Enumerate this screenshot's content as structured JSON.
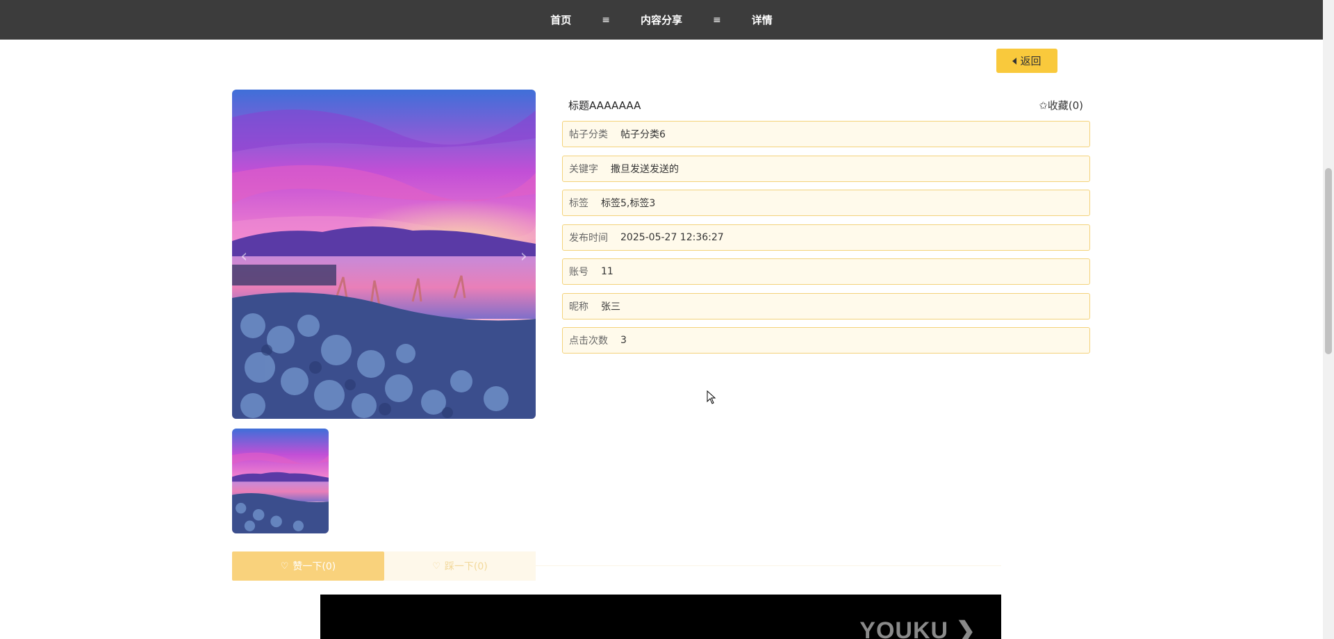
{
  "nav": {
    "crumbs": [
      "首页",
      "内容分享",
      "详情"
    ],
    "separator": "≡"
  },
  "back_button": {
    "label": "返回"
  },
  "post": {
    "title": "标题AAAAAAA",
    "favorite_label": "✩收藏(0)"
  },
  "fields": [
    {
      "key": "帖子分类",
      "value": "帖子分类6"
    },
    {
      "key": "关键字",
      "value": "撒旦发送发送的"
    },
    {
      "key": "标签",
      "value": "标签5,标签3"
    },
    {
      "key": "发布时间",
      "value": "2025-05-27 12:36:27"
    },
    {
      "key": "账号",
      "value": "11"
    },
    {
      "key": "昵称",
      "value": "张三"
    },
    {
      "key": "点击次数",
      "value": "3"
    }
  ],
  "actions": {
    "like_label": "赞一下(0)",
    "dislike_label": "踩一下(0)"
  },
  "video": {
    "logo": "YOUKU"
  },
  "colors": {
    "topbar": "#3c3c3c",
    "accent": "#f9c93c",
    "field_bg": "#fffaeb",
    "field_border": "#f3d27a"
  }
}
